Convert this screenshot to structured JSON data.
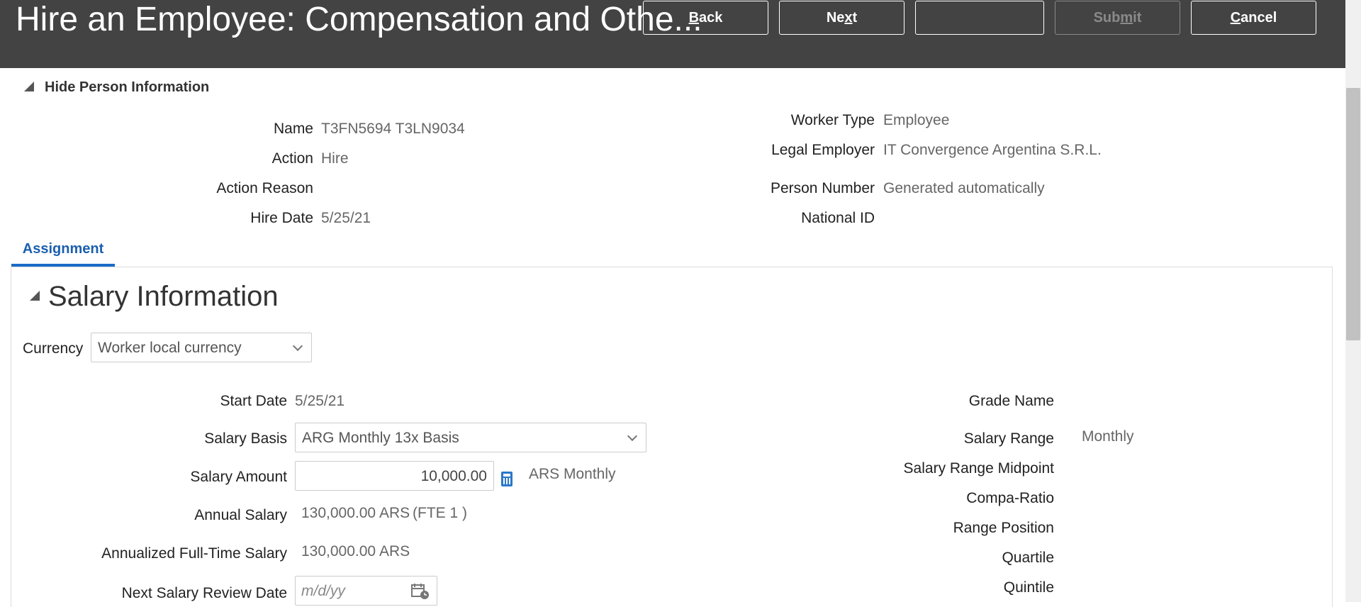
{
  "header": {
    "title": "Hire an Employee: Compensation and Othe...",
    "back": {
      "pre": "",
      "key": "B",
      "post": "ack"
    },
    "next": {
      "pre": "Ne",
      "key": "x",
      "post": "t"
    },
    "blank_button": "",
    "submit": {
      "pre": "Sub",
      "key": "m",
      "post": "it"
    },
    "cancel": {
      "pre": "",
      "key": "C",
      "post": "ancel"
    }
  },
  "person_info": {
    "toggle_label": "Hide Person Information",
    "fields": {
      "name": {
        "label": "Name",
        "value": "T3FN5694 T3LN9034"
      },
      "action": {
        "label": "Action",
        "value": "Hire"
      },
      "action_reason": {
        "label": "Action Reason",
        "value": ""
      },
      "hire_date": {
        "label": "Hire Date",
        "value": "5/25/21"
      },
      "worker_type": {
        "label": "Worker Type",
        "value": "Employee"
      },
      "legal_employer": {
        "label": "Legal Employer",
        "value": "IT Convergence Argentina S.R.L."
      },
      "person_number": {
        "label": "Person Number",
        "value": "Generated automatically"
      },
      "national_id": {
        "label": "National ID",
        "value": ""
      }
    }
  },
  "tabs": [
    {
      "label": "Assignment"
    }
  ],
  "salary": {
    "section_title": "Salary Information",
    "currency": {
      "label": "Currency",
      "value": "Worker local currency"
    },
    "start_date": {
      "label": "Start Date",
      "value": "5/25/21"
    },
    "salary_basis": {
      "label": "Salary Basis",
      "value": "ARG Monthly 13x Basis"
    },
    "salary_amount": {
      "label": "Salary Amount",
      "value": "10,000.00",
      "currency": "ARS",
      "frequency": "Monthly"
    },
    "annual_salary": {
      "label": "Annual Salary",
      "value": "130,000.00",
      "currency": "ARS",
      "fte": "(FTE 1 )"
    },
    "annualized_fulltime": {
      "label": "Annualized Full-Time Salary",
      "value": "130,000.00",
      "currency": "ARS"
    },
    "next_review": {
      "label": "Next Salary Review Date",
      "placeholder": "m/d/yy"
    },
    "grade_name": {
      "label": "Grade Name",
      "value": ""
    },
    "salary_range": {
      "label": "Salary Range",
      "value": "Monthly"
    },
    "range_midpoint": {
      "label": "Salary Range Midpoint",
      "value": ""
    },
    "compa_ratio": {
      "label": "Compa-Ratio",
      "value": ""
    },
    "range_position": {
      "label": "Range Position",
      "value": ""
    },
    "quartile": {
      "label": "Quartile",
      "value": ""
    },
    "quintile": {
      "label": "Quintile",
      "value": ""
    }
  },
  "colors": {
    "header_bg": "#434343",
    "accent": "#1b6ac9",
    "calculator_icon": "#2a78c8"
  },
  "icons": {
    "disclosure": "triangle-down-right-icon",
    "calculator": "calculator-icon",
    "calendar": "calendar-icon",
    "dropdown": "chevron-down-icon"
  }
}
